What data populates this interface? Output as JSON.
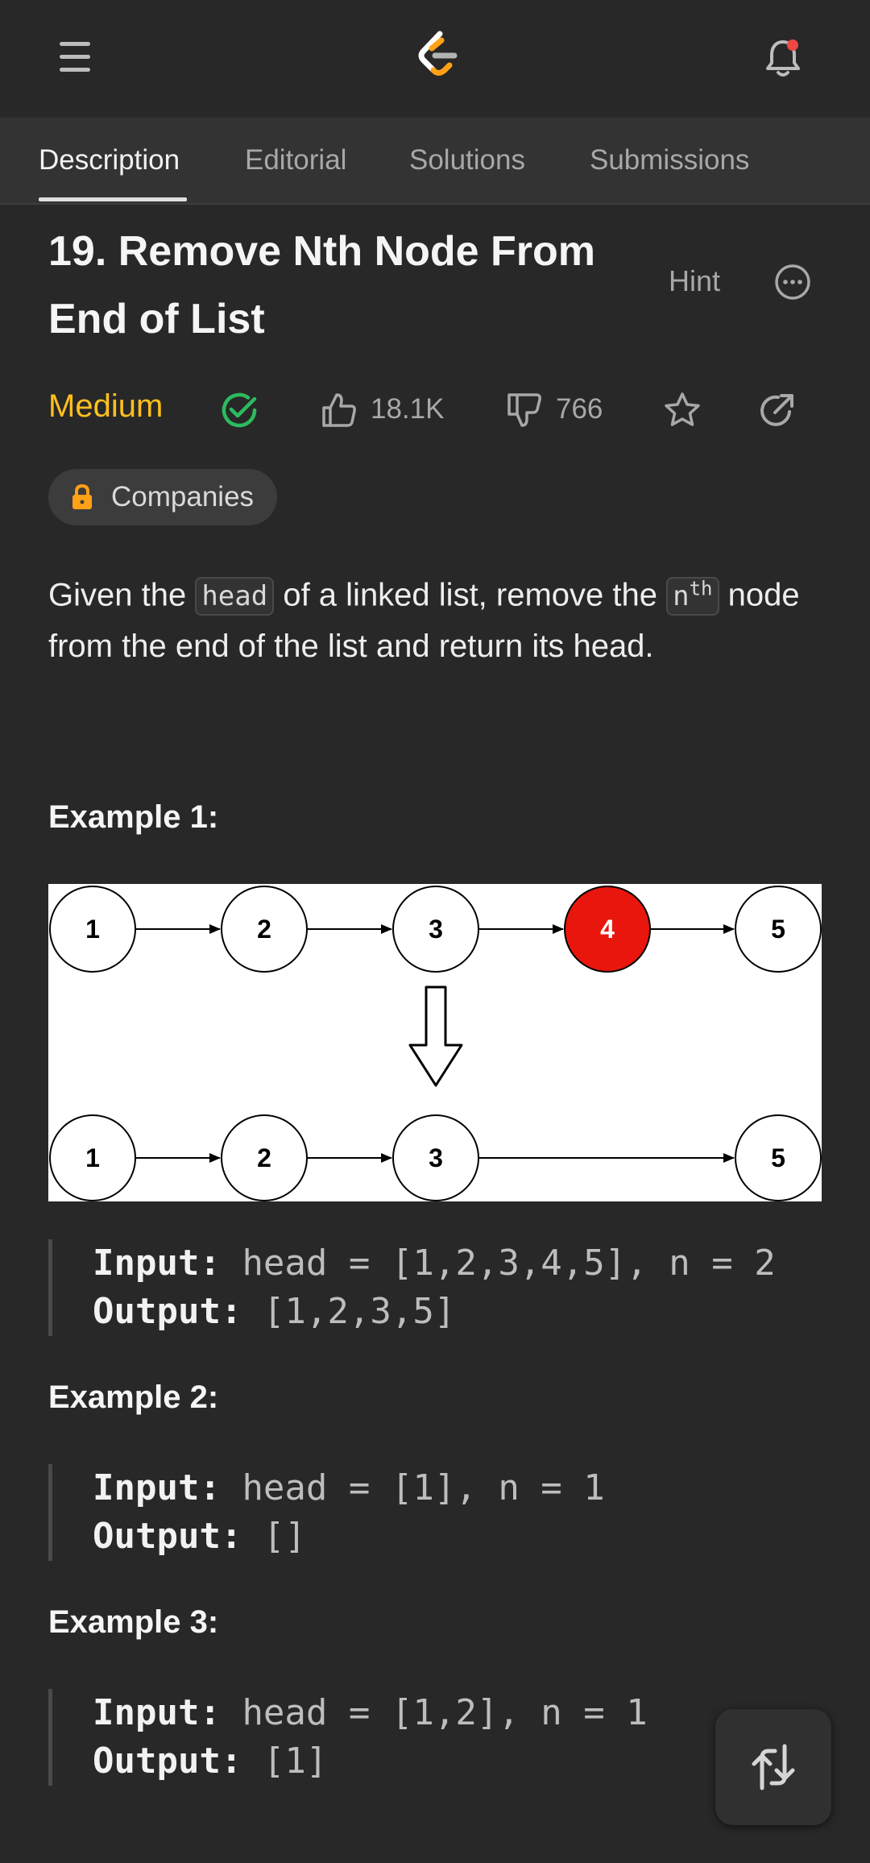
{
  "header": {
    "menu_icon": "hamburger-menu-icon",
    "logo_icon": "leetcode-logo-icon",
    "notification_icon": "bell-icon"
  },
  "tabs": [
    {
      "label": "Description",
      "active": true
    },
    {
      "label": "Editorial",
      "active": false
    },
    {
      "label": "Solutions",
      "active": false
    },
    {
      "label": "Submissions",
      "active": false
    }
  ],
  "problem": {
    "title_line1": "19. Remove Nth Node From",
    "title_line2": "End of List",
    "hint_label": "Hint",
    "difficulty": "Medium",
    "likes": "18.1K",
    "dislikes": "766",
    "companies_label": "Companies",
    "description": {
      "part1": "Given the ",
      "code1": "head",
      "part2": " of a linked list, remove the ",
      "code2_base": "n",
      "code2_sup": "th",
      "part3": " node from the end of the list and return its head."
    }
  },
  "diagram": {
    "top_nodes": [
      "1",
      "2",
      "3",
      "4",
      "5"
    ],
    "bottom_nodes": [
      "1",
      "2",
      "3",
      "5"
    ],
    "removed_node": "4",
    "removed_color": "#e8160c"
  },
  "examples": [
    {
      "heading": "Example 1:",
      "input_label": "Input:",
      "input_value": " head = [1,2,3,4,5], n = 2",
      "output_label": "Output:",
      "output_value": " [1,2,3,5]"
    },
    {
      "heading": "Example 2:",
      "input_label": "Input:",
      "input_value": " head = [1], n = 1",
      "output_label": "Output:",
      "output_value": " []"
    },
    {
      "heading": "Example 3:",
      "input_label": "Input:",
      "input_value": " head = [1,2], n = 1",
      "output_label": "Output:",
      "output_value": " [1]"
    }
  ],
  "colors": {
    "background": "#282828",
    "medium": "#ffc01e",
    "solved": "#2cbb5d",
    "lock": "#ffa116",
    "notification_dot": "#ef4743"
  }
}
